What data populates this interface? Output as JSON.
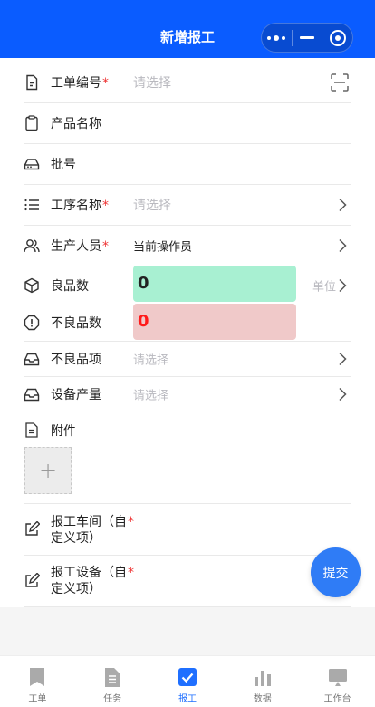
{
  "page": {
    "title": "新增报工"
  },
  "form": {
    "rows": [
      {
        "label": "工单编号",
        "required": "*",
        "value": "请选择"
      },
      {
        "label": "产品名称",
        "required": "",
        "value": ""
      },
      {
        "label": "批号",
        "required": "",
        "value": ""
      },
      {
        "label": "工序名称",
        "required": "*",
        "value": "请选择"
      },
      {
        "label": "生产人员",
        "required": "*",
        "value": "当前操作员"
      },
      {
        "label": "良品数",
        "required": "",
        "value": "0",
        "unit": "单位"
      },
      {
        "label": "不良品数",
        "required": "",
        "value": "0"
      },
      {
        "label": "不良品项",
        "required": "",
        "value": "请选择"
      },
      {
        "label": "设备产量",
        "required": "",
        "value": "请选择"
      }
    ],
    "attachment_label": "附件",
    "upload_symbol": "+",
    "custom_fields": [
      {
        "line1": "报工车间（自",
        "line2": "定义项）",
        "required": "*"
      },
      {
        "line1": "报工设备（自",
        "line2": "定义项）",
        "required": "*"
      }
    ]
  },
  "submit_label": "提交",
  "tabs": [
    {
      "label": "工单",
      "icon": "bookmark-icon",
      "active": false
    },
    {
      "label": "任务",
      "icon": "document-icon",
      "active": false
    },
    {
      "label": "报工",
      "icon": "checkbox-icon",
      "active": true
    },
    {
      "label": "数据",
      "icon": "bar-chart-icon",
      "active": false
    },
    {
      "label": "工作台",
      "icon": "monitor-icon",
      "active": false
    }
  ],
  "colors": {
    "header": "#0a5cff",
    "accent": "#2f7cf6",
    "good_bg": "#a8f0d2",
    "bad_bg": "#f0c9c9",
    "bad_text": "#ff1a1a"
  }
}
